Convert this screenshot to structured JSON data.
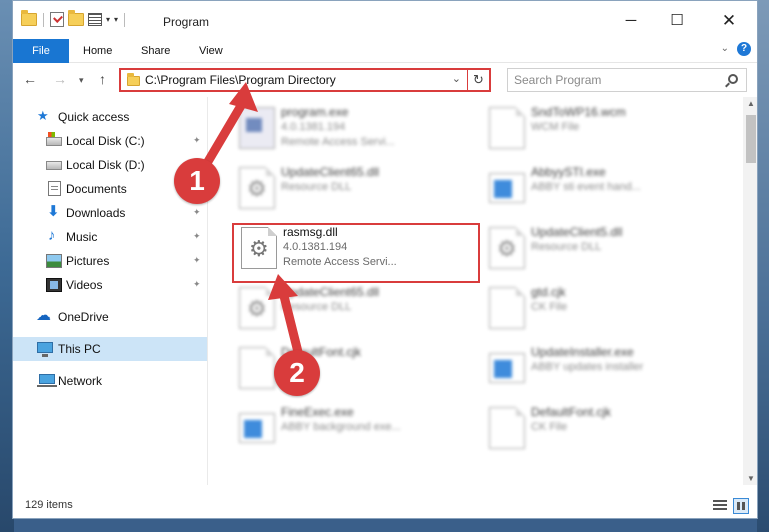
{
  "window": {
    "title": "Program",
    "minimize_glyph": "─",
    "maximize_glyph": "☐",
    "close_glyph": "✕"
  },
  "ribbon": {
    "tabs": [
      "File",
      "Home",
      "Share",
      "View"
    ],
    "help_glyph": "?",
    "collapse_glyph": "⌄"
  },
  "nav": {
    "back_glyph": "←",
    "forward_glyph": "→",
    "recent_glyph": "▾",
    "up_glyph": "↑",
    "address": "C:\\Program Files\\Program Directory",
    "dropdown_glyph": "⌄",
    "refresh_glyph": "↻",
    "search_placeholder": "Search Program"
  },
  "sidebar": {
    "items": [
      {
        "label": "Quick access",
        "icon": "star-icon",
        "pinned": false
      },
      {
        "label": "Local Disk (C:)",
        "icon": "disk-icon",
        "pinned": true
      },
      {
        "label": "Local Disk (D:)",
        "icon": "disk-icon",
        "pinned": true
      },
      {
        "label": "Documents",
        "icon": "documents-icon",
        "pinned": true
      },
      {
        "label": "Downloads",
        "icon": "downloads-icon",
        "pinned": true
      },
      {
        "label": "Music",
        "icon": "music-icon",
        "pinned": true
      },
      {
        "label": "Pictures",
        "icon": "pictures-icon",
        "pinned": true
      },
      {
        "label": "Videos",
        "icon": "videos-icon",
        "pinned": true
      },
      {
        "label": "OneDrive",
        "icon": "cloud-icon",
        "pinned": false
      },
      {
        "label": "This PC",
        "icon": "computer-icon",
        "pinned": false,
        "selected": true
      },
      {
        "label": "Network",
        "icon": "network-icon",
        "pinned": false
      }
    ],
    "pin_glyph": "📌"
  },
  "files": {
    "left": [
      {
        "name": "program.exe",
        "line2": "4.0.1381.194",
        "line3": "Remote Access Servi...",
        "icon": "program-icon"
      },
      {
        "name": "UpdateClient65.dll",
        "line2": "Resource DLL",
        "line3": "",
        "icon": "dll-icon"
      },
      {
        "name": "rasmsg.dll",
        "line2": "4.0.1381.194",
        "line3": "Remote Access Servi...",
        "icon": "dll-icon"
      },
      {
        "name": "UpdateClient65.dll",
        "line2": "Resource DLL",
        "line3": "",
        "icon": "dll-icon"
      },
      {
        "name": "DefaultFont.cjk",
        "line2": "",
        "line3": "",
        "icon": "file-icon"
      },
      {
        "name": "FineExec.exe",
        "line2": "ABBY background exe...",
        "line3": "",
        "icon": "exe-icon"
      }
    ],
    "right": [
      {
        "name": "SndToWP16.wcm",
        "line2": "WCM File",
        "icon": "file-icon"
      },
      {
        "name": "AbbyySTI.exe",
        "line2": "ABBY sti event hand...",
        "icon": "exe-icon"
      },
      {
        "name": "UpdateClient5.dll",
        "line2": "Resource DLL",
        "icon": "dll-icon"
      },
      {
        "name": "gtd.cjk",
        "line2": "CK File",
        "icon": "file-icon"
      },
      {
        "name": "UpdateInstaller.exe",
        "line2": "ABBY updates installer",
        "icon": "exe-icon"
      },
      {
        "name": "DefaultFont.cjk",
        "line2": "CK File",
        "icon": "file-icon"
      }
    ]
  },
  "callouts": {
    "one": "1",
    "two": "2"
  },
  "status": {
    "item_count": "129 items"
  },
  "colors": {
    "accent": "#1976d2",
    "highlight": "#d93c3c",
    "selection": "#cce4f7"
  }
}
